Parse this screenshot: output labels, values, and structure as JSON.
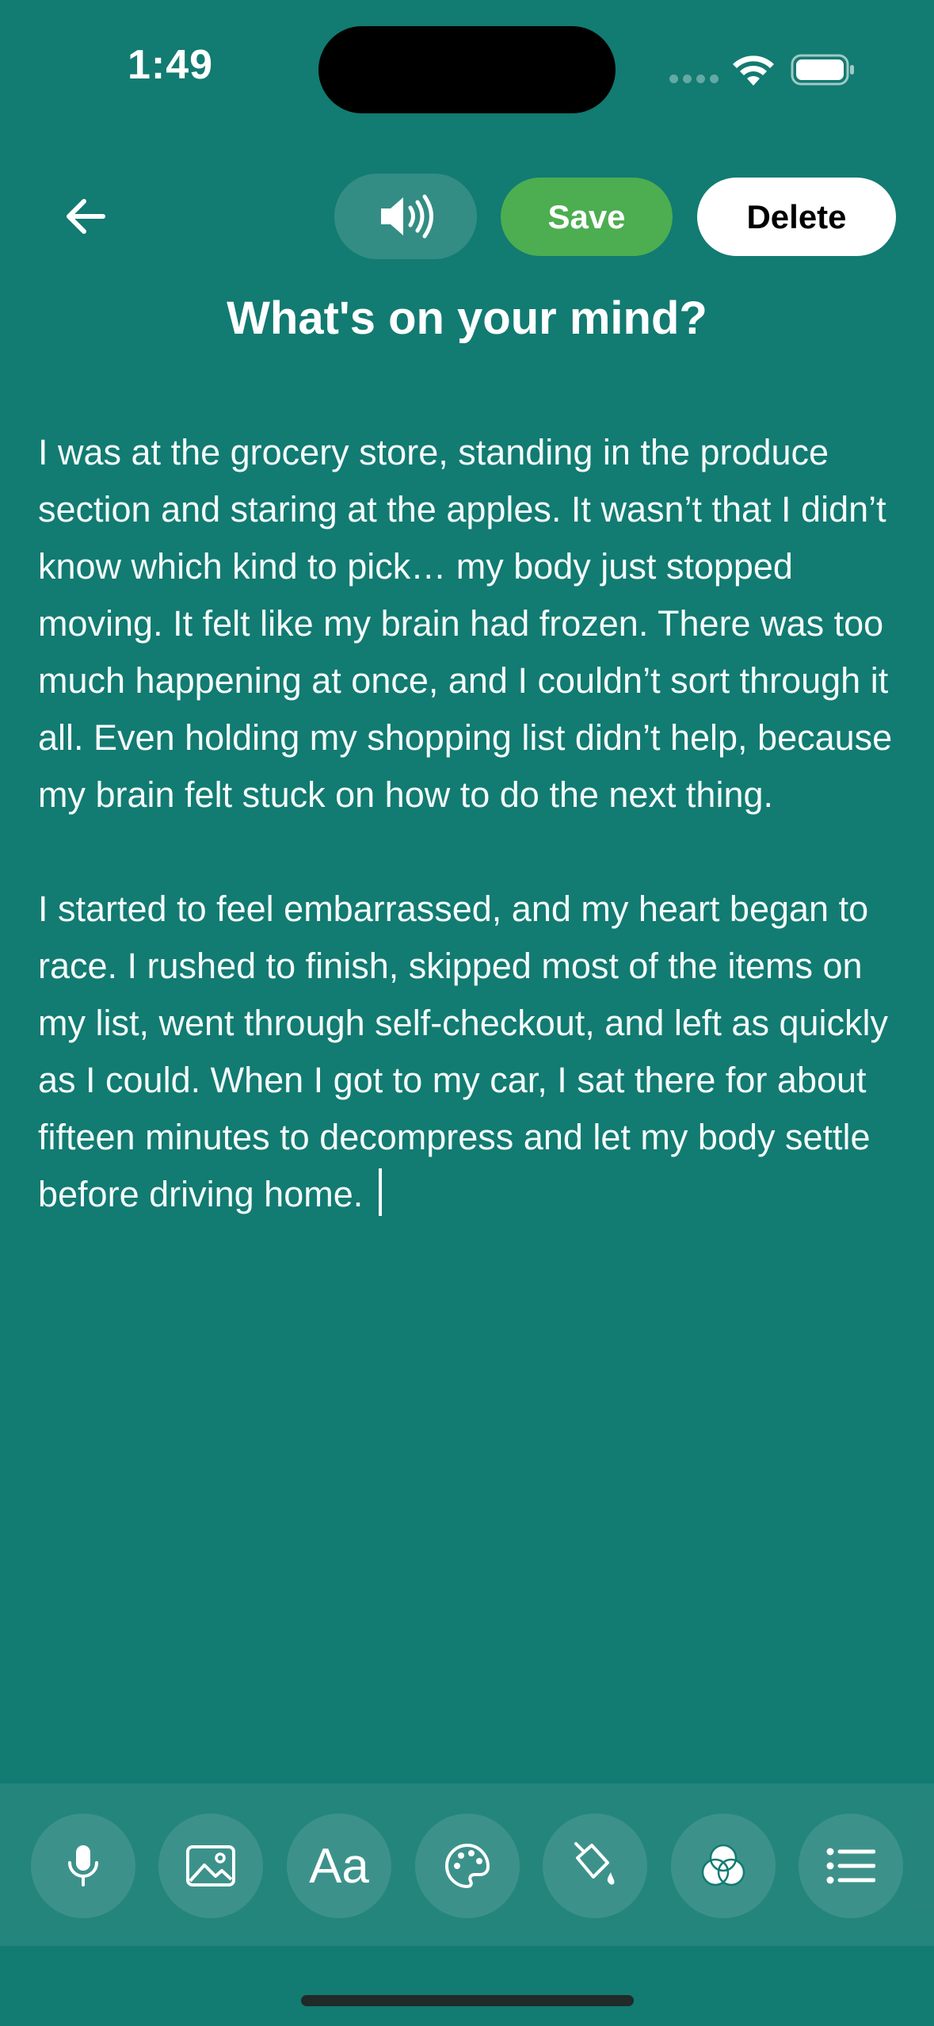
{
  "status_bar": {
    "time": "1:49"
  },
  "header": {
    "back_icon": "arrow-left-icon",
    "speaker_icon": "speaker-volume-icon",
    "save_label": "Save",
    "delete_label": "Delete"
  },
  "page": {
    "title": "What's on your mind?"
  },
  "editor": {
    "paragraphs": [
      "I was at the grocery store, standing in the produce section and staring at the apples. It wasn’t that I didn’t know which kind to pick… my body just stopped moving. It felt like my brain had frozen. There was too much happening at once, and I couldn’t sort through it all. Even holding my shopping list didn’t help, because my brain felt stuck on how to do the next thing.",
      "I started to feel embarrassed, and my heart began to race. I rushed to finish, skipped most of the items on my list, went through self-checkout, and left as quickly as I could. When I got to my car, I sat there for about fifteen minutes to decompress and let my body settle before driving home."
    ]
  },
  "toolbar": {
    "tools": [
      {
        "icon": "microphone-icon"
      },
      {
        "icon": "image-icon"
      },
      {
        "icon": "font-icon",
        "label": "Aa"
      },
      {
        "icon": "palette-icon"
      },
      {
        "icon": "paint-bucket-icon"
      },
      {
        "icon": "color-filter-icon"
      },
      {
        "icon": "list-icon"
      }
    ]
  },
  "colors": {
    "background": "#127b72",
    "save": "#4cae50",
    "delete": "#ffffff"
  }
}
